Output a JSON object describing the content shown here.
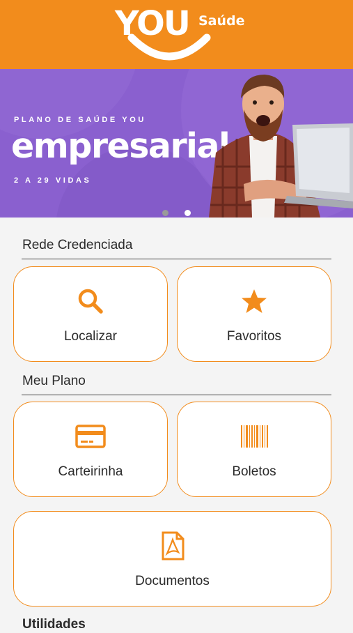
{
  "header": {
    "logo_you": "YOU",
    "logo_saude": "Saúde",
    "background_color": "#f28c1c"
  },
  "banner": {
    "eyebrow": "PLANO DE SAÚDE YOU",
    "title": "empresarial",
    "subtitle": "2 A 29 VIDAS",
    "background_color": "#8a60cf",
    "carousel_active_index": 2,
    "carousel_total": 2
  },
  "sections": {
    "rede": {
      "title": "Rede Credenciada",
      "items": [
        {
          "label": "Localizar",
          "icon": "search-icon"
        },
        {
          "label": "Favoritos",
          "icon": "star-icon"
        }
      ]
    },
    "plano": {
      "title": "Meu Plano",
      "items": [
        {
          "label": "Carteirinha",
          "icon": "card-icon"
        },
        {
          "label": "Boletos",
          "icon": "barcode-icon"
        },
        {
          "label": "Documentos",
          "icon": "pdf-icon"
        }
      ]
    },
    "utilidades": {
      "title": "Utilidades"
    }
  },
  "colors": {
    "accent": "#f28c1c",
    "banner": "#8a60cf",
    "text": "#2b2b2b"
  }
}
